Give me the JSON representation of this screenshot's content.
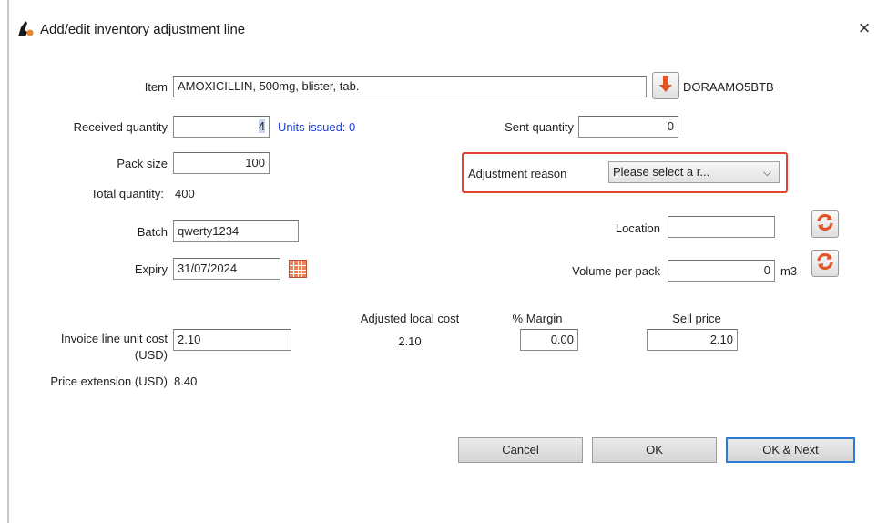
{
  "dialog": {
    "title": "Add/edit inventory adjustment line",
    "close_glyph": "×"
  },
  "item": {
    "label": "Item",
    "value": "AMOXICILLIN, 500mg, blister, tab.",
    "lookup_icon": "down-arrow-icon",
    "code": "DORAAMO5BTB"
  },
  "received_quantity": {
    "label": "Received quantity",
    "value": "4"
  },
  "units_issued": "Units issued: 0",
  "sent_quantity": {
    "label": "Sent quantity",
    "value": "0"
  },
  "pack_size": {
    "label": "Pack size",
    "value": "100"
  },
  "adjustment_reason": {
    "label": "Adjustment reason",
    "selected": "Please select a r..."
  },
  "total_quantity": {
    "label": "Total quantity:",
    "value": "400"
  },
  "batch": {
    "label": "Batch",
    "value": "qwerty1234"
  },
  "location": {
    "label": "Location",
    "value": ""
  },
  "expiry": {
    "label": "Expiry",
    "value": "31/07/2024",
    "calendar_icon": "calendar-icon"
  },
  "volume_per_pack": {
    "label": "Volume per pack",
    "value": "0",
    "unit": "m3"
  },
  "refresh_icon": "refresh-icon",
  "invoice_cost": {
    "label_line1": "Invoice line unit cost",
    "label_line2": "(USD)",
    "value": "2.10"
  },
  "adjusted_local_cost": {
    "label": "Adjusted local cost",
    "value": "2.10"
  },
  "margin": {
    "label": "% Margin",
    "value": "0.00"
  },
  "sell_price": {
    "label": "Sell price",
    "value": "2.10"
  },
  "price_extension": {
    "label": "Price extension (USD)",
    "value": "8.40"
  },
  "buttons": {
    "cancel": "Cancel",
    "ok": "OK",
    "ok_next": "OK & Next"
  },
  "colors": {
    "accent_blue": "#1b3fd8",
    "highlight_red": "#e2452d",
    "default_button_border": "#2f7bd2"
  }
}
